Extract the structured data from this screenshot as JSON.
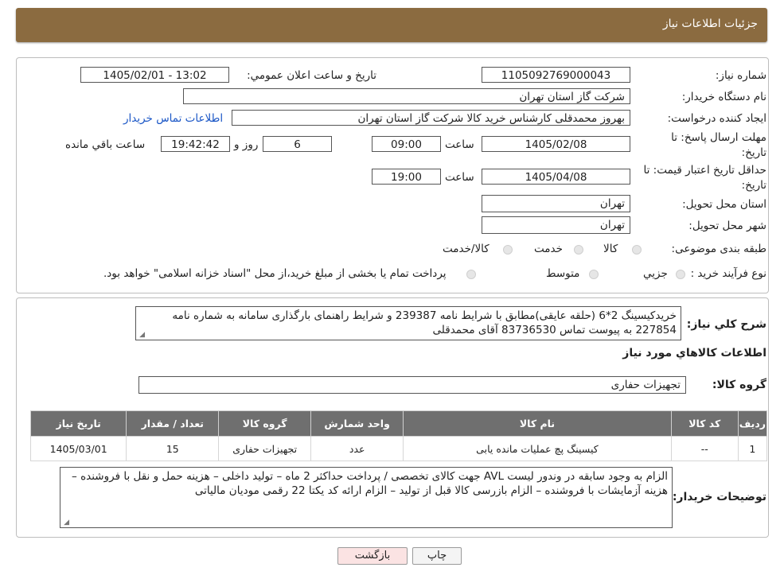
{
  "header": {
    "title": "جزئیات اطلاعات نیاز"
  },
  "form": {
    "need_number_label": "شماره نیاز:",
    "need_number": "1105092769000043",
    "announce_label": "تاریخ و ساعت اعلان عمومي:",
    "announce_value": "1405/02/01 - 13:02",
    "buyer_org_label": "نام دستگاه خريدار:",
    "buyer_org": "شرکت گاز استان تهران",
    "requester_label": "ايجاد کننده درخواست:",
    "requester": "بهروز محمدقلی کارشناس خرید کالا شرکت گاز استان تهران",
    "contact_link": "اطلاعات تماس خريدار",
    "deadline_label_1": "مهلت ارسال پاسخ: تا",
    "deadline_label_2": "تاريخ:",
    "deadline_date": "1405/02/08",
    "time_label": "ساعت",
    "deadline_time": "09:00",
    "days": "6",
    "days_label": "روز و",
    "remaining_time": "19:42:42",
    "remaining_label": "ساعت باقي مانده",
    "validity_label_1": "حداقل تاريخ اعتبار قيمت: تا",
    "validity_label_2": "تاريخ:",
    "validity_date": "1405/04/08",
    "validity_time": "19:00",
    "province_label": "استان محل تحويل:",
    "province": "تهران",
    "city_label": "شهر محل تحويل:",
    "city": "تهران",
    "category_label": "طبقه بندی موضوعی:",
    "category_options": [
      "کالا",
      "خدمت",
      "کالا/خدمت"
    ],
    "process_label": "نوع فرآيند خريد :",
    "process_options": [
      "جزيي",
      "متوسط"
    ],
    "process_note": "پرداخت تمام يا بخشی از مبلغ خريد،از محل \"اسناد خزانه اسلامی\" خواهد بود."
  },
  "summary": {
    "label": "شرح کلي نياز:",
    "text": "خریدکیسینگ 2*6 (حلقه عایقی)مطابق با شرایط نامه 239387 و شرایط راهنمای بارگذاری سامانه به شماره نامه 227854 به پیوست تماس 83736530 آقای محمدقلی",
    "goods_info_title": "اطلاعات کالاهاي مورد نياز",
    "group_label": "گروه کالا:",
    "group_value": "تجهيزات حفاری"
  },
  "table": {
    "headers": [
      "رديف",
      "کد کالا",
      "نام کالا",
      "واحد شمارش",
      "گروه کالا",
      "تعداد / مقدار",
      "تاريخ نياز"
    ],
    "rows": [
      [
        "1",
        "--",
        "کیسینگ پچ عملیات مانده یابی",
        "عدد",
        "تجهيزات حفاری",
        "15",
        "1405/03/01"
      ]
    ]
  },
  "buyer_notes": {
    "label": "توضيحات خريدار:",
    "text": "الزام به وجود سابقه در وندور لیست AVL جهت کالای تخصصی / پرداخت حداکثر 2 ماه – تولید  داخلی – هزینه حمل و نقل با فروشنده – هزینه آزمایشات با فروشنده – الزام بازرسی کالا قبل از تولید – الزام ارائه  کد یکتا  22 رقمی مودیان مالیاتی"
  },
  "buttons": {
    "print": "چاپ",
    "back": "بازگشت"
  },
  "colors": {
    "header_bg": "#8b6b40",
    "table_header_bg": "#6f6f6f",
    "back_button_bg": "#fbe3e3",
    "link": "#1a56c6"
  }
}
